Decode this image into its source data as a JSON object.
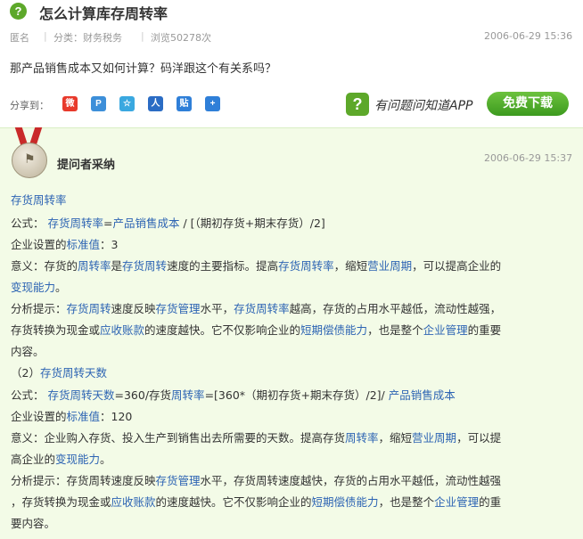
{
  "question": {
    "title": "怎么计算库存周转率",
    "author": "匿名",
    "category": "分类：财务税务",
    "views": "浏览50278次",
    "date": "2006-06-29 15:36",
    "body": "那产品销售成本又如何计算？码洋跟这个有关系吗？",
    "icon": "question-mark-icon"
  },
  "share": {
    "label": "分享到：",
    "icons": [
      "weibo-icon",
      "qzone-icon",
      "star-icon",
      "renren-icon",
      "tieba-icon",
      "plus-icon"
    ],
    "icon_glyphs": [
      "微",
      "P",
      "☆",
      "人",
      "贴",
      "+"
    ],
    "icon_colors": [
      "#e8392b",
      "#3d8fd9",
      "#3aa8e0",
      "#2b6cc4",
      "#2f7fd8",
      "#2f7fd8"
    ]
  },
  "promo": {
    "text": "有问题问知道APP",
    "button": "免费下载",
    "logo_glyph": "?"
  },
  "answer": {
    "label": "提问者采纳",
    "date": "2006-06-29 15:37",
    "colors": {
      "background": "#f3fbe7",
      "link": "#2d64b3",
      "accent": "#5da82a"
    },
    "lines": [
      [
        {
          "t": "存货周转率",
          "l": true
        }
      ],
      [
        {
          "t": "公式： "
        },
        {
          "t": "存货周转率",
          "l": true
        },
        {
          "t": "="
        },
        {
          "t": "产品销售成本",
          "l": true
        },
        {
          "t": " / [（期初存货+期末存货）/2]"
        }
      ],
      [
        {
          "t": "企业设置的"
        },
        {
          "t": "标准值",
          "l": true
        },
        {
          "t": "：3"
        }
      ],
      [
        {
          "t": "意义：存货的"
        },
        {
          "t": "周转率",
          "l": true
        },
        {
          "t": "是"
        },
        {
          "t": "存货周转",
          "l": true
        },
        {
          "t": "速度的主要指标。提高"
        },
        {
          "t": "存货周转率",
          "l": true
        },
        {
          "t": "，缩短"
        },
        {
          "t": "营业周期",
          "l": true
        },
        {
          "t": "，可以提高企业的"
        }
      ],
      [
        {
          "t": "变现能力",
          "l": true
        },
        {
          "t": "。"
        }
      ],
      [
        {
          "t": "分析提示："
        },
        {
          "t": "存货周转",
          "l": true
        },
        {
          "t": "速度反映"
        },
        {
          "t": "存货管理",
          "l": true
        },
        {
          "t": "水平，"
        },
        {
          "t": "存货周转率",
          "l": true
        },
        {
          "t": "越高，存货的占用水平越低，流动性越强，"
        }
      ],
      [
        {
          "t": "存货转换为现金或"
        },
        {
          "t": "应收账款",
          "l": true
        },
        {
          "t": "的速度越快。它不仅影响企业的"
        },
        {
          "t": "短期偿债能力",
          "l": true
        },
        {
          "t": "，也是整个"
        },
        {
          "t": "企业管理",
          "l": true
        },
        {
          "t": "的重要"
        }
      ],
      [
        {
          "t": "内容。"
        }
      ],
      [
        {
          "t": "（2）"
        },
        {
          "t": "存货周转天数",
          "l": true
        }
      ],
      [
        {
          "t": "公式： "
        },
        {
          "t": "存货周转天数",
          "l": true
        },
        {
          "t": "=360/存货"
        },
        {
          "t": "周转率",
          "l": true
        },
        {
          "t": "=[360*（期初存货+期末存货）/2]/ "
        },
        {
          "t": "产品销售成本",
          "l": true
        }
      ],
      [
        {
          "t": "企业设置的"
        },
        {
          "t": "标准值",
          "l": true
        },
        {
          "t": "：120"
        }
      ],
      [
        {
          "t": "意义：企业购入存货、投入生产到销售出去所需要的天数。提高存货"
        },
        {
          "t": "周转率",
          "l": true
        },
        {
          "t": "，缩短"
        },
        {
          "t": "营业周期",
          "l": true
        },
        {
          "t": "，可以提"
        }
      ],
      [
        {
          "t": "高企业的"
        },
        {
          "t": "变现能力",
          "l": true
        },
        {
          "t": "。"
        }
      ],
      [
        {
          "t": "分析提示：存货周转速度反映"
        },
        {
          "t": "存货管理",
          "l": true
        },
        {
          "t": "水平，存货周转速度越快，存货的占用水平越低，流动性越强"
        }
      ],
      [
        {
          "t": "，存货转换为现金或"
        },
        {
          "t": "应收账款",
          "l": true
        },
        {
          "t": "的速度越快。它不仅影响企业的"
        },
        {
          "t": "短期偿债能力",
          "l": true
        },
        {
          "t": "，也是整个"
        },
        {
          "t": "企业管理",
          "l": true
        },
        {
          "t": "的重"
        }
      ],
      [
        {
          "t": "要内容。"
        }
      ]
    ]
  }
}
